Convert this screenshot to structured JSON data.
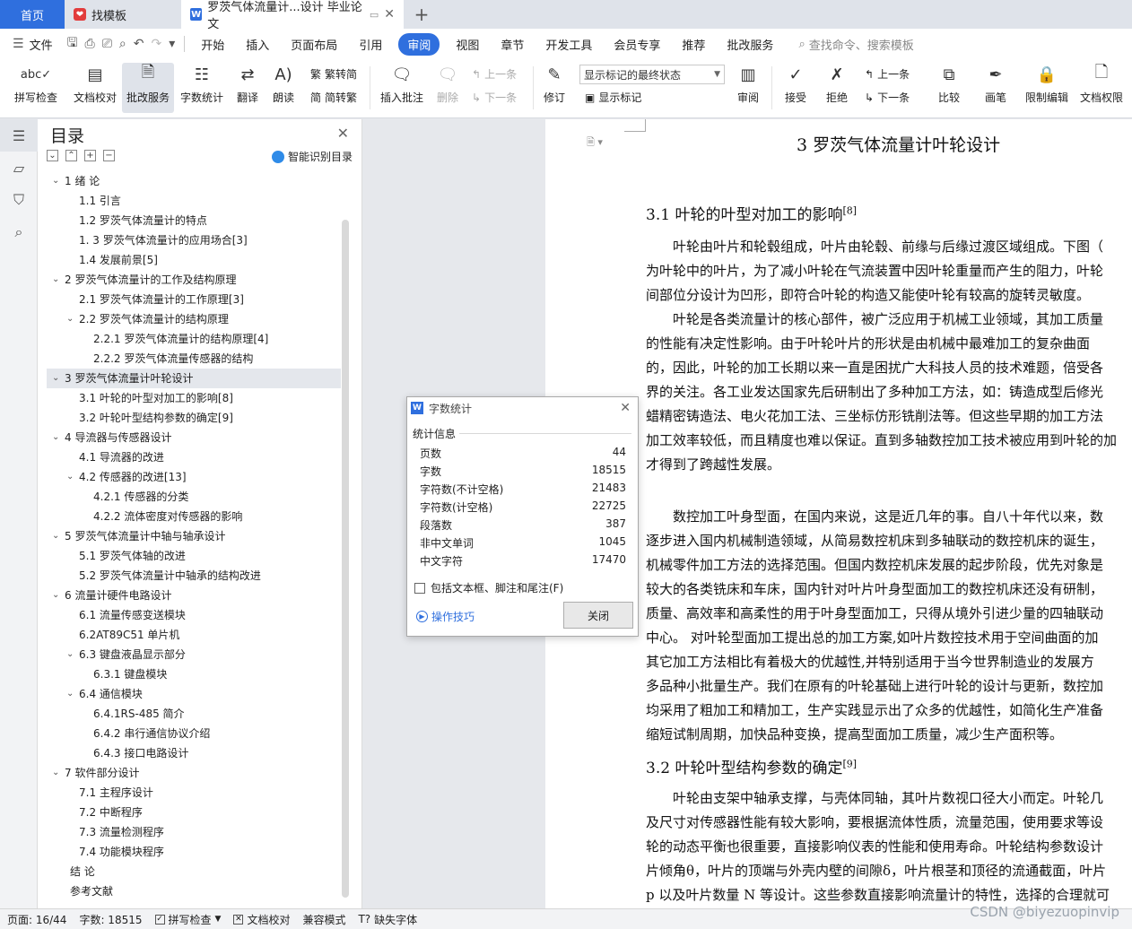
{
  "tabs": {
    "home": "首页",
    "t1": "找模板",
    "t2": "罗茨气体流量计...设计 毕业论文"
  },
  "menu": {
    "file": "文件",
    "items": [
      "开始",
      "插入",
      "页面布局",
      "引用",
      "审阅",
      "视图",
      "章节",
      "开发工具",
      "会员专享",
      "推荐",
      "批改服务"
    ],
    "active": "审阅",
    "search": "查找命令、搜索模板"
  },
  "ribbon": {
    "spell": "拼写检查",
    "proof": "文档校对",
    "revise_service": "批改服务",
    "word_count": "字数统计",
    "translate": "翻译",
    "read": "朗读",
    "to_trad": "繁转简",
    "to_simp": "简转繁",
    "insert_comment": "插入批注",
    "delete": "删除",
    "prev": "上一条",
    "next": "下一条",
    "track": "修订",
    "markup_select": "显示标记的最终状态",
    "show_markup": "显示标记",
    "review": "审阅",
    "accept": "接受",
    "reject": "拒绝",
    "prev2": "上一条",
    "next2": "下一条",
    "compare": "比较",
    "pen": "画笔",
    "restrict": "限制编辑",
    "perm": "文档权限"
  },
  "toc": {
    "title": "目录",
    "smart": "智能识别目录",
    "items": [
      {
        "text": "1 绪    论",
        "level": 1,
        "caret": true
      },
      {
        "text": "1.1  引言",
        "level": 2
      },
      {
        "text": "1.2  罗茨气体流量计的特点",
        "level": 2
      },
      {
        "text": "1. 3 罗茨气体流量计的应用场合[3]",
        "level": 2
      },
      {
        "text": "1.4  发展前景[5]",
        "level": 2
      },
      {
        "text": "2 罗茨气体流量计的工作及结构原理",
        "level": 1,
        "caret": true
      },
      {
        "text": "2.1  罗茨气体流量计的工作原理[3]",
        "level": 2
      },
      {
        "text": "2.2 罗茨气体流量计的结构原理",
        "level": 2,
        "caret": true
      },
      {
        "text": "2.2.1  罗茨气体流量计的结构原理[4]",
        "level": 3
      },
      {
        "text": "2.2.2  罗茨气体流量传感器的结构",
        "level": 3
      },
      {
        "text": "3 罗茨气体流量计叶轮设计",
        "level": 1,
        "caret": true,
        "selected": true
      },
      {
        "text": "3.1 叶轮的叶型对加工的影响[8]",
        "level": 2
      },
      {
        "text": "3.2 叶轮叶型结构参数的确定[9]",
        "level": 2
      },
      {
        "text": "4  导流器与传感器设计",
        "level": 1,
        "caret": true
      },
      {
        "text": "4.1 导流器的改进",
        "level": 2
      },
      {
        "text": "4.2 传感器的改进[13]",
        "level": 2,
        "caret": true
      },
      {
        "text": "4.2.1  传感器的分类",
        "level": 3
      },
      {
        "text": "4.2.2 流体密度对传感器的影响",
        "level": 3
      },
      {
        "text": "5  罗茨气体流量计中轴与轴承设计",
        "level": 1,
        "caret": true
      },
      {
        "text": "5.1  罗茨气体轴的改进",
        "level": 2
      },
      {
        "text": "5.2  罗茨气体流量计中轴承的结构改进",
        "level": 2
      },
      {
        "text": "6 流量计硬件电路设计",
        "level": 1,
        "caret": true
      },
      {
        "text": "6.1 流量传感变送模块",
        "level": 2
      },
      {
        "text": "6.2AT89C51 单片机",
        "level": 2
      },
      {
        "text": "6.3 键盘液晶显示部分",
        "level": 2,
        "caret": true
      },
      {
        "text": "6.3.1  键盘模块",
        "level": 3
      },
      {
        "text": "6.4 通信模块",
        "level": 2,
        "caret": true
      },
      {
        "text": "6.4.1RS-485 简介",
        "level": 3
      },
      {
        "text": "6.4.2 串行通信协议介绍",
        "level": 3
      },
      {
        "text": "6.4.3 接口电路设计",
        "level": 3
      },
      {
        "text": "7  软件部分设计",
        "level": 1,
        "caret": true
      },
      {
        "text": "7.1    主程序设计",
        "level": 2
      },
      {
        "text": "7.2    中断程序",
        "level": 2
      },
      {
        "text": "7.3  流量检测程序",
        "level": 2
      },
      {
        "text": "7.4    功能模块程序",
        "level": 2
      },
      {
        "text": "结    论",
        "level": 0
      },
      {
        "text": "参考文献",
        "level": 0
      }
    ]
  },
  "doc": {
    "chapter_title": "3 罗茨气体流量计叶轮设计",
    "h31": "3.1 叶轮的叶型对加工的影响",
    "h31_ref": "[8]",
    "h32": "3.2 叶轮叶型结构参数的确定",
    "h32_ref": "[9]",
    "lines_a": [
      "　　叶轮由叶片和轮毂组成，叶片由轮毂、前缘与后缘过渡区域组成。下图（",
      "为叶轮中的叶片，为了减小叶轮在气流装置中因叶轮重量而产生的阻力，叶轮",
      "间部位分设计为凹形，即符合叶轮的构造又能使叶轮有较高的旋转灵敏度。",
      "　　叶轮是各类流量计的核心部件，被广泛应用于机械工业领域，其加工质量",
      "的性能有决定性影响。由于叶轮叶片的形状是由机械中最难加工的复杂曲面",
      "的，因此，叶轮的加工长期以来一直是困扰广大科技人员的技术难题，倍受各",
      "界的关注。各工业发达国家先后研制出了多种加工方法，如：铸造成型后修光",
      "蜡精密铸造法、电火花加工法、三坐标仿形铣削法等。但这些早期的加工方法",
      "加工效率较低，而且精度也难以保证。直到多轴数控加工技术被应用到叶轮的加",
      "才得到了跨越性发展。"
    ],
    "lines_b": [
      "　　数控加工叶身型面，在国内来说，这是近几年的事。自八十年代以来，数",
      "逐步进入国内机械制造领域，从简易数控机床到多轴联动的数控机床的诞生，",
      "机械零件加工方法的选择范围。但国内数控机床发展的起步阶段，优先对象是",
      "较大的各类铣床和车床，国内针对叶片叶身型面加工的数控机床还没有研制，",
      "质量、高效率和高柔性的用于叶身型面加工，只得从境外引进少量的四轴联动",
      "中心。  对叶轮型面加工提出总的加工方案,如叶片数控技术用于空间曲面的加",
      "其它加工方法相比有着极大的优越性,并特别适用于当今世界制造业的发展方",
      "多品种小批量生产。我们在原有的叶轮基础上进行叶轮的设计与更新，数控加",
      "均采用了粗加工和精加工，生产实践显示出了众多的优越性，如简化生产准备",
      "缩短试制周期，加快品种变换，提高型面加工质量，减少生产面积等。"
    ],
    "lines_c": [
      "　　叶轮由支架中轴承支撑，与壳体同轴，其叶片数视口径大小而定。叶轮几",
      "及尺寸对传感器性能有较大影响，要根据流体性质，流量范围，使用要求等设",
      "轮的动态平衡也很重要，直接影响仪表的性能和使用寿命。叶轮结构参数设计",
      "片倾角θ，叶片的顶端与外壳内壁的间隙δ，叶片根茎和顶径的流通截面，叶片",
      "p 以及叶片数量 N 等设计。这些参数直接影响流量计的特性，选择的合理就可"
    ]
  },
  "dialog": {
    "title": "字数统计",
    "section": "统计信息",
    "rows": [
      {
        "label": "页数",
        "value": "44"
      },
      {
        "label": "字数",
        "value": "18515"
      },
      {
        "label": "字符数(不计空格)",
        "value": "21483"
      },
      {
        "label": "字符数(计空格)",
        "value": "22725"
      },
      {
        "label": "段落数",
        "value": "387"
      },
      {
        "label": "非中文单词",
        "value": "1045"
      },
      {
        "label": "中文字符",
        "value": "17470"
      }
    ],
    "checkbox": "包括文本框、脚注和尾注(F)",
    "tips": "操作技巧",
    "close": "关闭"
  },
  "status": {
    "page": "页面: 16/44",
    "words": "字数: 18515",
    "spell": "拼写检查",
    "proof": "文档校对",
    "compat": "兼容模式",
    "missing_font": "缺失字体"
  },
  "watermark": "CSDN @biyezuopinvip"
}
